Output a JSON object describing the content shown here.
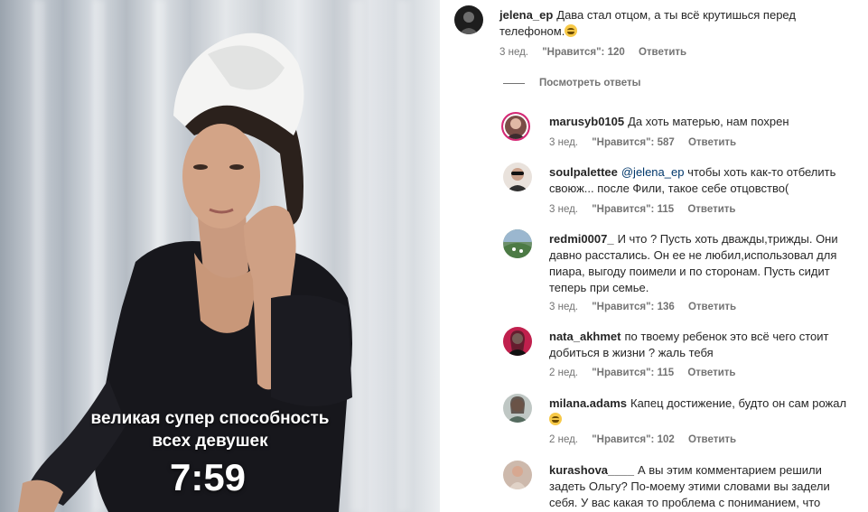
{
  "video": {
    "overlay_line1": "великая супер способность",
    "overlay_line2": "всех девушек",
    "overlay_timer": "7:59"
  },
  "top_comment": {
    "username": "jelena_ep",
    "text": "Дава стал отцом, а ты всё крутишься перед телефоном.",
    "emoji": "grinning-sweat-emoji",
    "time": "3 нед.",
    "likes": "\"Нравится\": 120",
    "reply_label": "Ответить"
  },
  "view_replies_label": "Посмотреть ответы",
  "replies": [
    {
      "username": "marusyb0105",
      "text": "Да хоть матерью, нам похрен",
      "time": "3 нед.",
      "likes": "\"Нравится\": 587",
      "reply_label": "Ответить"
    },
    {
      "username": "soulpalettee",
      "mention": "@jelena_ep",
      "text": "чтобы хоть как-то отбелить своюж... после Фили, такое себе отцовство(",
      "time": "3 нед.",
      "likes": "\"Нравится\": 115",
      "reply_label": "Ответить"
    },
    {
      "username": "redmi0007_",
      "text": "И что ? Пусть хоть дважды,трижды. Они давно расстались. Он ее не любил,использовал для пиара, выгоду поимели и по сторонам. Пусть сидит теперь при семье.",
      "time": "3 нед.",
      "likes": "\"Нравится\": 136",
      "reply_label": "Ответить"
    },
    {
      "username": "nata_akhmet",
      "text": "по твоему ребенок это всё чего стоит добиться в жизни ? жаль тебя",
      "time": "2 нед.",
      "likes": "\"Нравится\": 115",
      "reply_label": "Ответить"
    },
    {
      "username": "milana.adams",
      "text": "Капец достижение, будто он сам рожал",
      "emoji": "grinning-sweat-emoji",
      "time": "2 нед.",
      "likes": "\"Нравится\": 102",
      "reply_label": "Ответить"
    },
    {
      "username": "kurashova____",
      "text": "А вы этим комментарием решили задеть Ольгу? По-моему этими словами вы задели себя. У вас какая то проблема с пониманием, что",
      "time": "",
      "likes": "",
      "reply_label": ""
    }
  ],
  "colors": {
    "mention": "#00376b",
    "meta": "#737373",
    "text": "#262626",
    "ring": "#d62976"
  }
}
